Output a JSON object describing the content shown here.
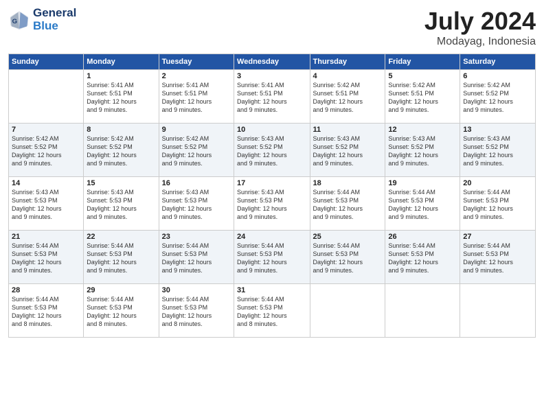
{
  "header": {
    "logo_line1": "General",
    "logo_line2": "Blue",
    "month_title": "July 2024",
    "location": "Modayag, Indonesia"
  },
  "days_of_week": [
    "Sunday",
    "Monday",
    "Tuesday",
    "Wednesday",
    "Thursday",
    "Friday",
    "Saturday"
  ],
  "weeks": [
    [
      null,
      {
        "num": "1",
        "info": "Sunrise: 5:41 AM\nSunset: 5:51 PM\nDaylight: 12 hours\nand 9 minutes."
      },
      {
        "num": "2",
        "info": "Sunrise: 5:41 AM\nSunset: 5:51 PM\nDaylight: 12 hours\nand 9 minutes."
      },
      {
        "num": "3",
        "info": "Sunrise: 5:41 AM\nSunset: 5:51 PM\nDaylight: 12 hours\nand 9 minutes."
      },
      {
        "num": "4",
        "info": "Sunrise: 5:42 AM\nSunset: 5:51 PM\nDaylight: 12 hours\nand 9 minutes."
      },
      {
        "num": "5",
        "info": "Sunrise: 5:42 AM\nSunset: 5:51 PM\nDaylight: 12 hours\nand 9 minutes."
      },
      {
        "num": "6",
        "info": "Sunrise: 5:42 AM\nSunset: 5:52 PM\nDaylight: 12 hours\nand 9 minutes."
      }
    ],
    [
      {
        "num": "7",
        "info": "Sunrise: 5:42 AM\nSunset: 5:52 PM\nDaylight: 12 hours\nand 9 minutes."
      },
      {
        "num": "8",
        "info": "Sunrise: 5:42 AM\nSunset: 5:52 PM\nDaylight: 12 hours\nand 9 minutes."
      },
      {
        "num": "9",
        "info": "Sunrise: 5:42 AM\nSunset: 5:52 PM\nDaylight: 12 hours\nand 9 minutes."
      },
      {
        "num": "10",
        "info": "Sunrise: 5:43 AM\nSunset: 5:52 PM\nDaylight: 12 hours\nand 9 minutes."
      },
      {
        "num": "11",
        "info": "Sunrise: 5:43 AM\nSunset: 5:52 PM\nDaylight: 12 hours\nand 9 minutes."
      },
      {
        "num": "12",
        "info": "Sunrise: 5:43 AM\nSunset: 5:52 PM\nDaylight: 12 hours\nand 9 minutes."
      },
      {
        "num": "13",
        "info": "Sunrise: 5:43 AM\nSunset: 5:52 PM\nDaylight: 12 hours\nand 9 minutes."
      }
    ],
    [
      {
        "num": "14",
        "info": "Sunrise: 5:43 AM\nSunset: 5:53 PM\nDaylight: 12 hours\nand 9 minutes."
      },
      {
        "num": "15",
        "info": "Sunrise: 5:43 AM\nSunset: 5:53 PM\nDaylight: 12 hours\nand 9 minutes."
      },
      {
        "num": "16",
        "info": "Sunrise: 5:43 AM\nSunset: 5:53 PM\nDaylight: 12 hours\nand 9 minutes."
      },
      {
        "num": "17",
        "info": "Sunrise: 5:43 AM\nSunset: 5:53 PM\nDaylight: 12 hours\nand 9 minutes."
      },
      {
        "num": "18",
        "info": "Sunrise: 5:44 AM\nSunset: 5:53 PM\nDaylight: 12 hours\nand 9 minutes."
      },
      {
        "num": "19",
        "info": "Sunrise: 5:44 AM\nSunset: 5:53 PM\nDaylight: 12 hours\nand 9 minutes."
      },
      {
        "num": "20",
        "info": "Sunrise: 5:44 AM\nSunset: 5:53 PM\nDaylight: 12 hours\nand 9 minutes."
      }
    ],
    [
      {
        "num": "21",
        "info": "Sunrise: 5:44 AM\nSunset: 5:53 PM\nDaylight: 12 hours\nand 9 minutes."
      },
      {
        "num": "22",
        "info": "Sunrise: 5:44 AM\nSunset: 5:53 PM\nDaylight: 12 hours\nand 9 minutes."
      },
      {
        "num": "23",
        "info": "Sunrise: 5:44 AM\nSunset: 5:53 PM\nDaylight: 12 hours\nand 9 minutes."
      },
      {
        "num": "24",
        "info": "Sunrise: 5:44 AM\nSunset: 5:53 PM\nDaylight: 12 hours\nand 9 minutes."
      },
      {
        "num": "25",
        "info": "Sunrise: 5:44 AM\nSunset: 5:53 PM\nDaylight: 12 hours\nand 9 minutes."
      },
      {
        "num": "26",
        "info": "Sunrise: 5:44 AM\nSunset: 5:53 PM\nDaylight: 12 hours\nand 9 minutes."
      },
      {
        "num": "27",
        "info": "Sunrise: 5:44 AM\nSunset: 5:53 PM\nDaylight: 12 hours\nand 9 minutes."
      }
    ],
    [
      {
        "num": "28",
        "info": "Sunrise: 5:44 AM\nSunset: 5:53 PM\nDaylight: 12 hours\nand 8 minutes."
      },
      {
        "num": "29",
        "info": "Sunrise: 5:44 AM\nSunset: 5:53 PM\nDaylight: 12 hours\nand 8 minutes."
      },
      {
        "num": "30",
        "info": "Sunrise: 5:44 AM\nSunset: 5:53 PM\nDaylight: 12 hours\nand 8 minutes."
      },
      {
        "num": "31",
        "info": "Sunrise: 5:44 AM\nSunset: 5:53 PM\nDaylight: 12 hours\nand 8 minutes."
      },
      null,
      null,
      null
    ]
  ]
}
